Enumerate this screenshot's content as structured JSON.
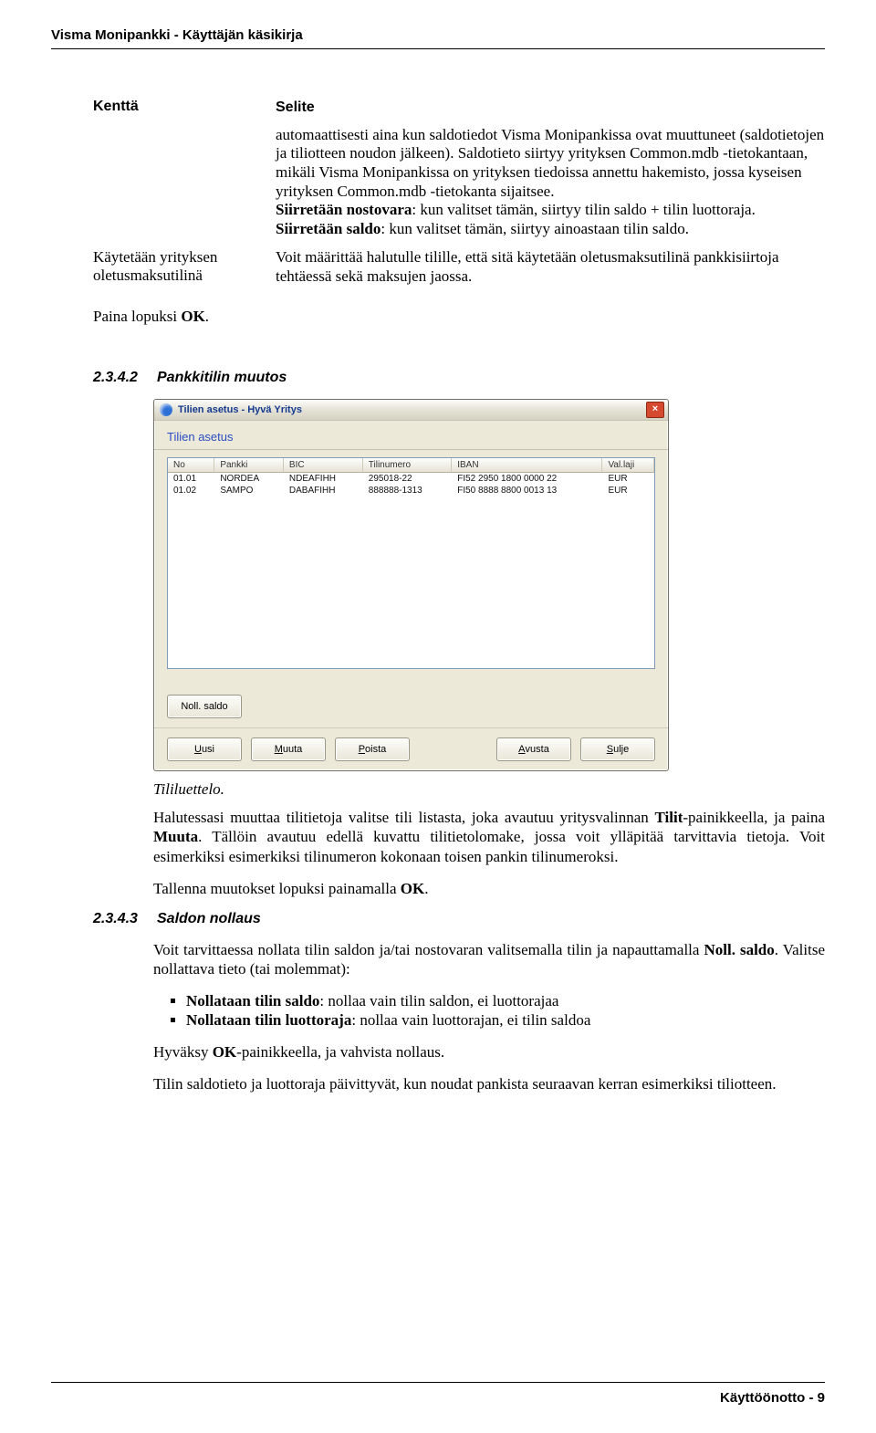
{
  "doc_header": "Visma Monipankki - Käyttäjän käsikirja",
  "kvtable": {
    "header": {
      "left": "Kenttä",
      "right": "Selite"
    },
    "rows": [
      {
        "left": "",
        "right_html": "automaattisesti aina kun saldotiedot Visma Monipankissa ovat muuttuneet (saldotietojen ja tiliotteen noudon jälkeen). Saldotieto siirtyy yrityksen Common.mdb -tietokantaan, mikäli Visma Monipankissa on yrityksen tiedoissa annettu hakemisto, jossa kyseisen yrityksen Common.mdb -tietokanta sijaitsee.<br><b>Siirretään nostovara</b>: kun valitset tämän, siirtyy tilin saldo + tilin luottoraja.<br><b>Siirretään saldo</b>: kun valitset tämän, siirtyy ainoastaan tilin saldo."
      },
      {
        "left": "Käytetään yrityksen oletusmaksutilinä",
        "right_html": "Voit määrittää halutulle tilille, että sitä käytetään oletusmaksutilinä pankkisiirtoja tehtäessä sekä maksujen jaossa."
      }
    ]
  },
  "press_ok": "Paina lopuksi <b>OK</b>.",
  "section2": {
    "index": "2.3.4.2",
    "title": "Pankkitilin muutos"
  },
  "section3": {
    "index": "2.3.4.3",
    "title": "Saldon nollaus"
  },
  "window": {
    "title": "Tilien asetus - Hyvä Yritys",
    "subheader": "Tilien asetus",
    "columns": [
      "No",
      "Pankki",
      "BIC",
      "Tilinumero",
      "IBAN",
      "Val.laji"
    ],
    "rows": [
      [
        "01.01",
        "NORDEA",
        "NDEAFIHH",
        "295018-22",
        "FI52 2950 1800 0000 22",
        "EUR"
      ],
      [
        "01.02",
        "SAMPO",
        "DABAFIHH",
        "888888-1313",
        "FI50 8888 8800 0013 13",
        "EUR"
      ]
    ],
    "btn_noll": "Noll. saldo",
    "btn_uusi": "Uusi",
    "btn_muuta": "Muuta",
    "btn_poista": "Poista",
    "btn_avusta": "Avusta",
    "btn_sulje": "Sulje",
    "u_uusi": "U",
    "u_muuta": "M",
    "u_poista": "P",
    "u_avusta": "A",
    "u_sulje": "S"
  },
  "caption": "Tililuettelo.",
  "para1": "Halutessasi muuttaa tilitietoja valitse tili listasta, joka avautuu yritysvalinnan <b>Tilit</b>-painikkeella, ja paina <b>Muuta</b>. Tällöin avautuu edellä kuvattu tilitietolomake, jossa voit ylläpitää tarvittavia tietoja. Voit esimerkiksi esimerkiksi tilinumeron kokonaan toisen pankin tilinumeroksi.",
  "para2": "Tallenna muutokset lopuksi painamalla <b>OK</b>.",
  "para3": "Voit tarvittaessa nollata tilin saldon ja/tai nostovaran valitsemalla tilin ja napauttamalla <b>Noll. saldo</b>. Valitse nollattava tieto (tai molemmat):",
  "bullets": [
    "<b>Nollataan tilin saldo</b>: nollaa vain tilin saldon, ei luottorajaa",
    "<b>Nollataan tilin luottoraja</b>: nollaa vain luottorajan, ei tilin saldoa"
  ],
  "para4": "Hyväksy <b>OK</b>-painikkeella, ja vahvista nollaus.",
  "para5": "Tilin saldotieto ja luottoraja päivittyvät, kun noudat pankista seuraavan kerran esimerkiksi tiliotteen.",
  "footer": "Käyttöönotto - 9"
}
